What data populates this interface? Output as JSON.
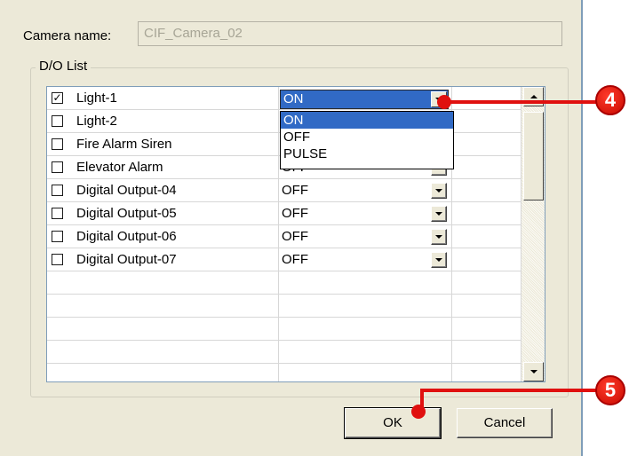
{
  "camera": {
    "label": "Camera name:",
    "value": "CIF_Camera_02"
  },
  "do_list": {
    "legend": "D/O List",
    "rows": [
      {
        "name": "Light-1",
        "checked": true,
        "value": "ON"
      },
      {
        "name": "Light-2",
        "checked": false,
        "value": ""
      },
      {
        "name": "Fire Alarm Siren",
        "checked": false,
        "value": ""
      },
      {
        "name": "Elevator Alarm",
        "checked": false,
        "value": "OFF"
      },
      {
        "name": "Digital Output-04",
        "checked": false,
        "value": "OFF"
      },
      {
        "name": "Digital Output-05",
        "checked": false,
        "value": "OFF"
      },
      {
        "name": "Digital Output-06",
        "checked": false,
        "value": "OFF"
      },
      {
        "name": "Digital Output-07",
        "checked": false,
        "value": "OFF"
      }
    ],
    "dropdown_options": [
      "ON",
      "OFF",
      "PULSE"
    ],
    "dropdown_highlighted": "ON"
  },
  "buttons": {
    "ok": "OK",
    "cancel": "Cancel"
  },
  "callouts": {
    "c4": "4",
    "c5": "5",
    "color": "#e0100f"
  },
  "colors": {
    "dialog_bg": "#ece9d8",
    "selection": "#316ac5"
  }
}
